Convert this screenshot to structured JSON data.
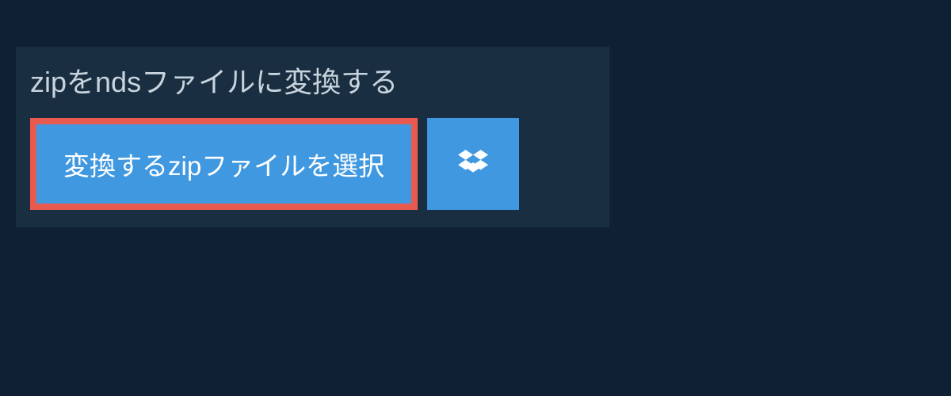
{
  "panel": {
    "title": "zipをndsファイルに変換する",
    "select_button_label": "変換するzipファイルを選択"
  },
  "icons": {
    "dropbox": "dropbox"
  },
  "colors": {
    "page_bg": "#0f2033",
    "panel_bg": "#1a2e42",
    "button_bg": "#4098e0",
    "highlight_border": "#e85a50",
    "text_light": "#c8d4dd"
  }
}
